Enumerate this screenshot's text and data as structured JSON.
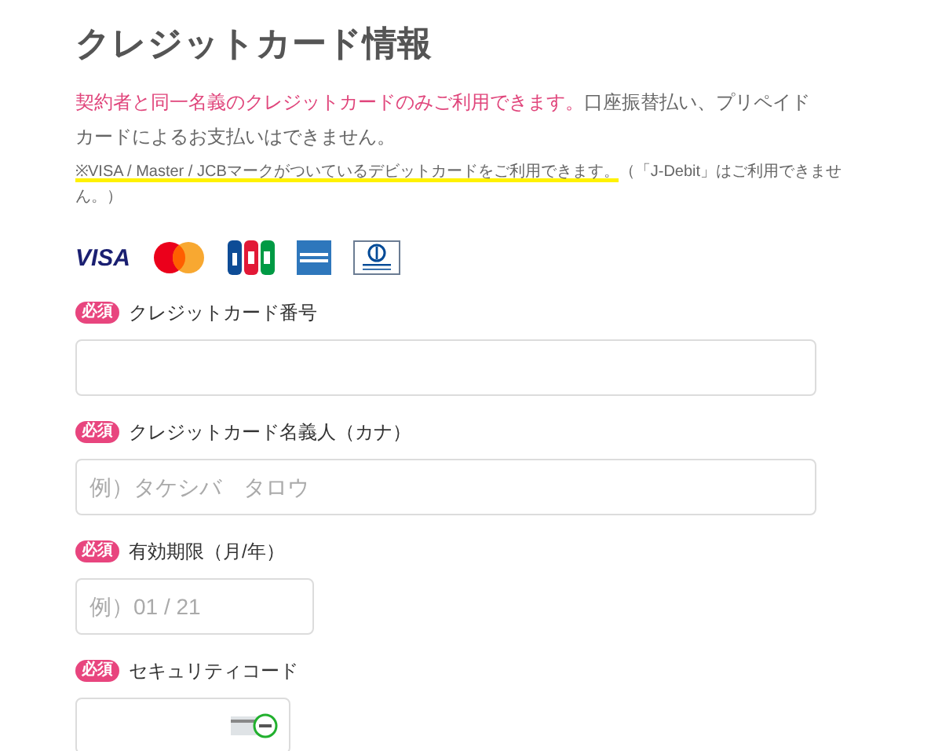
{
  "title": "クレジットカード情報",
  "notice": {
    "emphasis": "契約者と同一名義のクレジットカードのみご利用できます。",
    "rest": "口座振替払い、プリペイドカードによるお支払いはできません。"
  },
  "debit_note": {
    "highlighted": "※VISA / Master / JCBマークがついているデビットカードをご利用できます。",
    "rest": "（「J-Debit」はご利用できません。）"
  },
  "card_brands": [
    {
      "kind": "visa",
      "label": "VISA"
    },
    {
      "kind": "mastercard"
    },
    {
      "kind": "jcb"
    },
    {
      "kind": "amex"
    },
    {
      "kind": "diners"
    }
  ],
  "fields": [
    {
      "label": "クレジットカード番号",
      "badge": "必須",
      "kind": "wide"
    },
    {
      "label": "クレジットカード名義人（カナ）",
      "badge": "必須",
      "kind": "wide",
      "placeholder": "例）タケシバ　タロウ"
    },
    {
      "label": "有効期限（月/年）",
      "badge": "必須",
      "kind": "expiry",
      "placeholder": "例）01 / 21"
    },
    {
      "label": "セキュリティコード",
      "badge": "必須",
      "kind": "cvc"
    }
  ]
}
